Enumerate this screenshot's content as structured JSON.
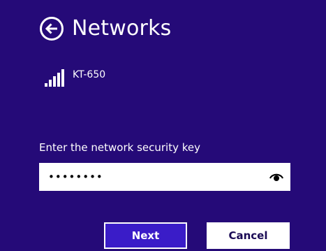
{
  "header": {
    "title": "Networks",
    "back_icon": "back-arrow-circle-icon"
  },
  "network": {
    "name": "KT-650",
    "signal_icon": "wifi-signal-icon",
    "signal_strength_bars": 5
  },
  "security": {
    "label": "Enter the network security key",
    "value": "••••••••",
    "reveal_icon": "eye-reveal-icon"
  },
  "buttons": {
    "next_label": "Next",
    "cancel_label": "Cancel"
  },
  "colors": {
    "background": "#250a78",
    "next_button": "#3a1cc8",
    "text": "#ffffff"
  }
}
